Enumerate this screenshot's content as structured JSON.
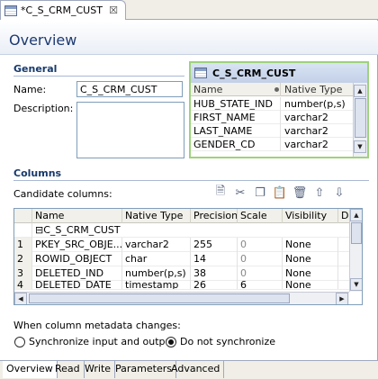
{
  "editor_tab": {
    "title": "*C_S_CRM_CUST",
    "close": "☒"
  },
  "page_title": "Overview",
  "general": {
    "heading": "General",
    "name_label": "Name:",
    "name_value": "C_S_CRM_CUST",
    "description_label": "Description:",
    "description_value": ""
  },
  "preview": {
    "title": "C_S_CRM_CUST",
    "headers": [
      "Name",
      "Native Type"
    ],
    "rows": [
      {
        "name": "HUB_STATE_IND",
        "type": "number(p,s)"
      },
      {
        "name": "FIRST_NAME",
        "type": "varchar2"
      },
      {
        "name": "LAST_NAME",
        "type": "varchar2"
      },
      {
        "name": "GENDER_CD",
        "type": "varchar2"
      }
    ]
  },
  "columns": {
    "heading": "Columns",
    "candidate_label": "Candidate columns:",
    "headers": [
      "Name",
      "Native Type",
      "Precision",
      "Scale",
      "Visibility",
      "D"
    ],
    "group_row": "C_S_CRM_CUST",
    "group_toggle": "⊟",
    "rows": [
      {
        "num": "1",
        "name": "PKEY_SRC_OBJE...",
        "type": "varchar2",
        "precision": "255",
        "scale": "0",
        "visibility": "None"
      },
      {
        "num": "2",
        "name": "ROWID_OBJECT",
        "type": "char",
        "precision": "14",
        "scale": "0",
        "visibility": "None"
      },
      {
        "num": "3",
        "name": "DELETED_IND",
        "type": "number(p,s)",
        "precision": "38",
        "scale": "0",
        "visibility": "None"
      },
      {
        "num": "4",
        "name": "DELETED_DATE",
        "type": "timestamp",
        "precision": "26",
        "scale": "6",
        "visibility": "None"
      }
    ]
  },
  "metadata": {
    "label": "When column metadata changes:",
    "option_sync": "Synchronize input and output",
    "option_nosync": "Do not synchronize",
    "selected": "nosync"
  },
  "bottom_tabs": [
    "Overview",
    "Read",
    "Write",
    "Parameters",
    "Advanced"
  ],
  "toolbar_icons": [
    "new-icon",
    "cut-icon",
    "copy-icon",
    "paste-icon",
    "delete-icon",
    "move-up-icon",
    "move-down-icon"
  ]
}
